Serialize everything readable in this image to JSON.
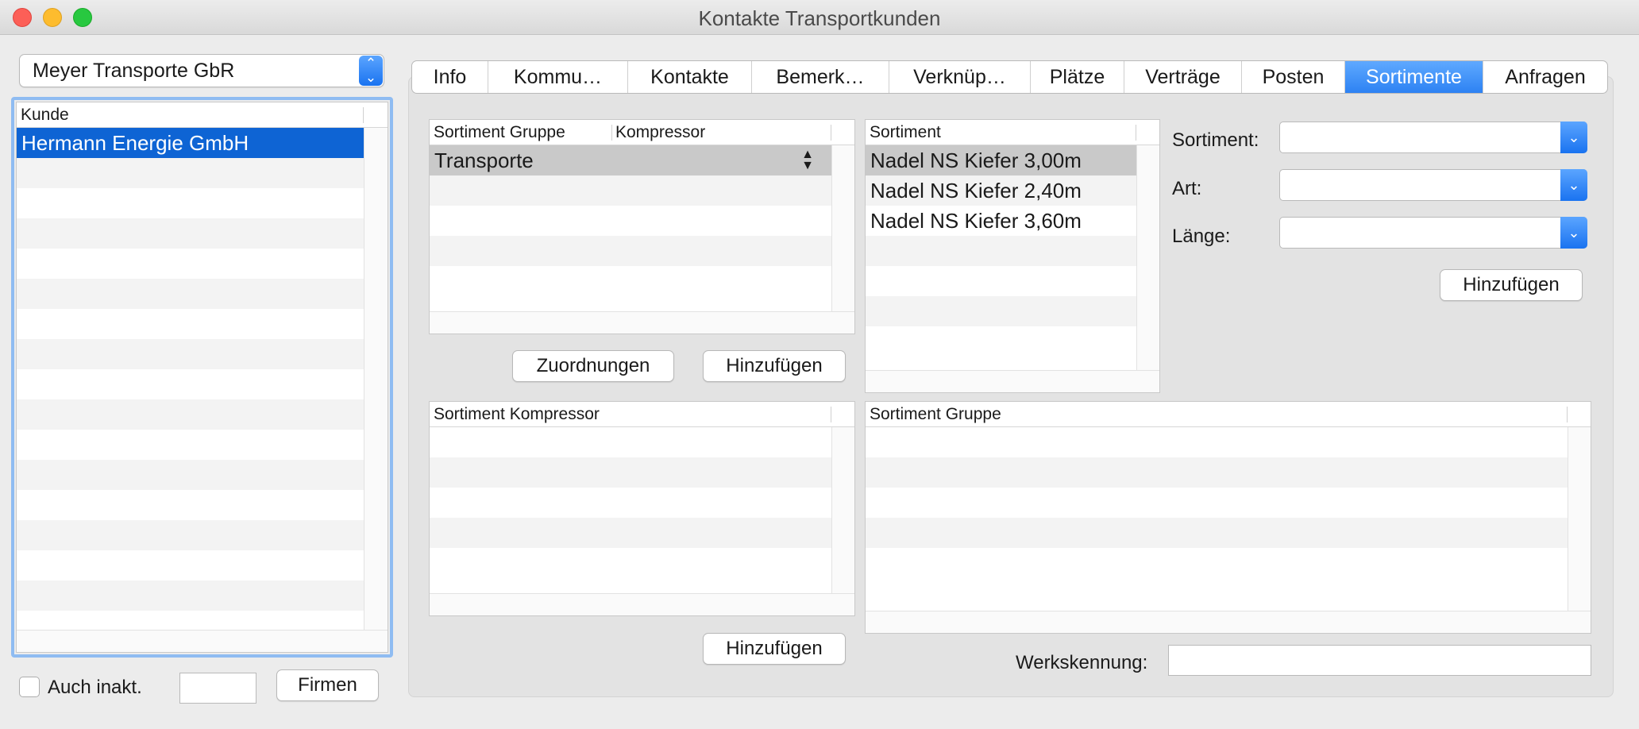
{
  "window": {
    "title": "Kontakte Transportkunden"
  },
  "company_select": {
    "value": "Meyer Transporte GbR"
  },
  "customer_table": {
    "header": "Kunde",
    "rows": [
      "Hermann Energie GmbH"
    ]
  },
  "bottom_left": {
    "inactive_checkbox_label": "Auch inakt.",
    "search_value": "",
    "firms_button": "Firmen"
  },
  "tabs": [
    {
      "label": "Info"
    },
    {
      "label": "Kommu…"
    },
    {
      "label": "Kontakte"
    },
    {
      "label": "Bemerk…"
    },
    {
      "label": "Verknüp…"
    },
    {
      "label": "Plätze"
    },
    {
      "label": "Verträge"
    },
    {
      "label": "Posten"
    },
    {
      "label": "Sortimente",
      "active": true
    },
    {
      "label": "Anfragen"
    }
  ],
  "group_table": {
    "headers": [
      "Sortiment Gruppe",
      "Kompressor"
    ],
    "rows": [
      "Transporte"
    ]
  },
  "assortment_table": {
    "header": "Sortiment",
    "rows": [
      "Nadel NS Kiefer 3,00m",
      "Nadel NS Kiefer 2,40m",
      "Nadel NS Kiefer 3,60m"
    ]
  },
  "buttons": {
    "assignments": "Zuordnungen",
    "add_group": "Hinzufügen",
    "add_right": "Hinzufügen",
    "add_compressor": "Hinzufügen"
  },
  "form": {
    "sortiment_label": "Sortiment:",
    "sortiment_value": "",
    "art_label": "Art:",
    "art_value": "",
    "length_label": "Länge:",
    "length_value": ""
  },
  "compressor_table": {
    "header": "Sortiment Kompressor"
  },
  "group2_table": {
    "header": "Sortiment Gruppe"
  },
  "werkskennung": {
    "label": "Werkskennung:",
    "value": ""
  }
}
